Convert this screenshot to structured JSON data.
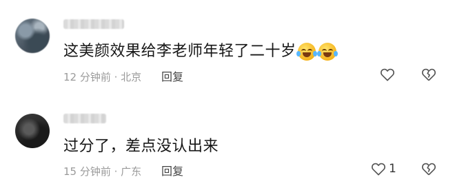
{
  "comments": [
    {
      "text": "这美颜效果给李老师年轻了二十岁",
      "emojis": [
        "laughing-tears-emoji",
        "laughing-tears-emoji"
      ],
      "time": "12 分钟前",
      "location": "北京",
      "reply_label": "回复",
      "like_count": ""
    },
    {
      "text": "过分了，差点没认出来",
      "emojis": [],
      "time": "15 分钟前",
      "location": "广东",
      "reply_label": "回复",
      "like_count": "1"
    }
  ],
  "separator": " · "
}
